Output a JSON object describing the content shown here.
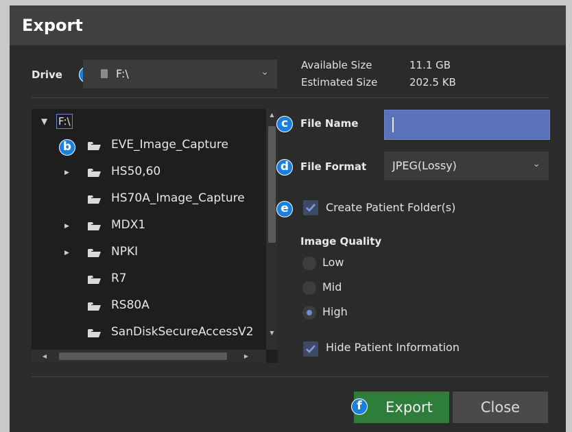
{
  "dialog": {
    "title": "Export"
  },
  "drive": {
    "label": "Drive",
    "selected": "F:\\",
    "marker": "a"
  },
  "sizes": {
    "available_label": "Available Size",
    "available_value": "11.1 GB",
    "estimated_label": "Estimated Size",
    "estimated_value": "202.5 KB"
  },
  "tree": {
    "root": "F:\\",
    "marker": "b",
    "items": [
      {
        "name": "EVE_Image_Capture",
        "expandable": false
      },
      {
        "name": "HS50,60",
        "expandable": true
      },
      {
        "name": "HS70A_Image_Capture",
        "expandable": false
      },
      {
        "name": "MDX1",
        "expandable": true
      },
      {
        "name": "NPKI",
        "expandable": true
      },
      {
        "name": "R7",
        "expandable": false
      },
      {
        "name": "RS80A",
        "expandable": false
      },
      {
        "name": "SanDiskSecureAccessV2",
        "expandable": false
      }
    ]
  },
  "file_name": {
    "label": "File Name",
    "value": "",
    "marker": "c"
  },
  "file_format": {
    "label": "File Format",
    "selected": "JPEG(Lossy)",
    "marker": "d"
  },
  "create_patient_folder": {
    "label": "Create Patient Folder(s)",
    "checked": true,
    "marker": "e"
  },
  "image_quality": {
    "label": "Image Quality",
    "options": [
      "Low",
      "Mid",
      "High"
    ],
    "selected": "High"
  },
  "hide_patient_info": {
    "label": "Hide Patient Information",
    "checked": true
  },
  "buttons": {
    "export": "Export",
    "export_marker": "f",
    "close": "Close"
  },
  "colors": {
    "dialog_bg": "#2b2b2b",
    "titlebar_bg": "#404040",
    "marker_blue": "#1b7fe0",
    "export_green": "#2e7d3a",
    "filename_field": "#5a72b8",
    "check_color": "#7b9be6"
  }
}
